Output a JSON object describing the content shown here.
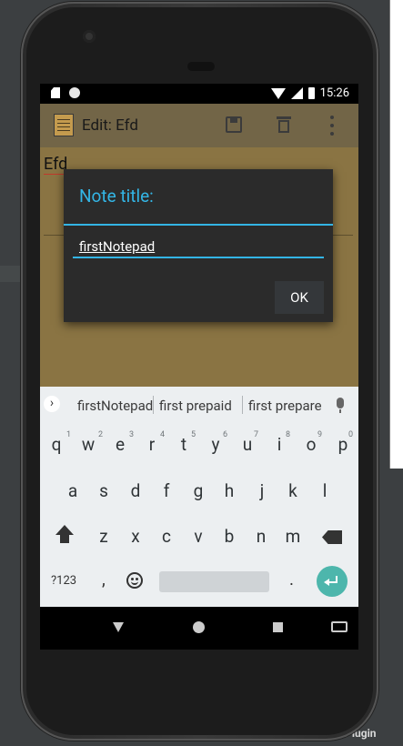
{
  "status_bar": {
    "time": "15:26"
  },
  "app_bar": {
    "title": "Edit: Efd"
  },
  "note": {
    "body_text": "Efd"
  },
  "dialog": {
    "title": "Note title:",
    "input_value": "firstNotepad",
    "ok_label": "OK"
  },
  "keyboard": {
    "suggestions": [
      "firstNotepad",
      "first prepaid",
      "first prepare"
    ],
    "row1": [
      "q",
      "w",
      "e",
      "r",
      "t",
      "y",
      "u",
      "i",
      "o",
      "p"
    ],
    "row1_hints": [
      "1",
      "2",
      "3",
      "4",
      "5",
      "6",
      "7",
      "8",
      "9",
      "0"
    ],
    "row2": [
      "a",
      "s",
      "d",
      "f",
      "g",
      "h",
      "j",
      "k",
      "l"
    ],
    "row3": [
      "z",
      "x",
      "c",
      "v",
      "b",
      "n",
      "m"
    ],
    "symbols_label": "?123",
    "comma_label": ",",
    "period_label": "."
  },
  "ide": {
    "bottom_text": "Platform and Plugin"
  },
  "colors": {
    "accent": "#33b5e5",
    "dialog_bg": "#2b2b2b",
    "note_bg": "#8a7443",
    "enter_key": "#4db6ac"
  }
}
